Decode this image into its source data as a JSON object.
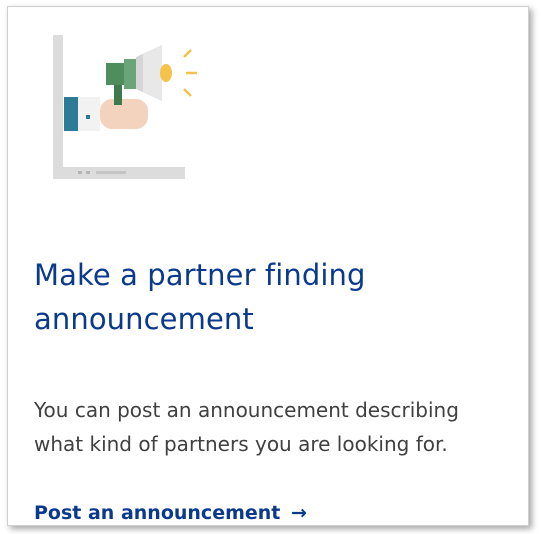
{
  "card": {
    "icon": "megaphone-laptop-icon",
    "title": "Make a partner finding announcement",
    "description": "You can post an announcement describing what kind of partners you are looking for.",
    "cta_label": "Post an announcement",
    "cta_arrow": "→"
  },
  "colors": {
    "title": "#0b3a8d",
    "text": "#404040",
    "accent_green": "#4f8d5f",
    "accent_teal": "#2c7b97",
    "accent_yellow": "#f5c24a"
  }
}
